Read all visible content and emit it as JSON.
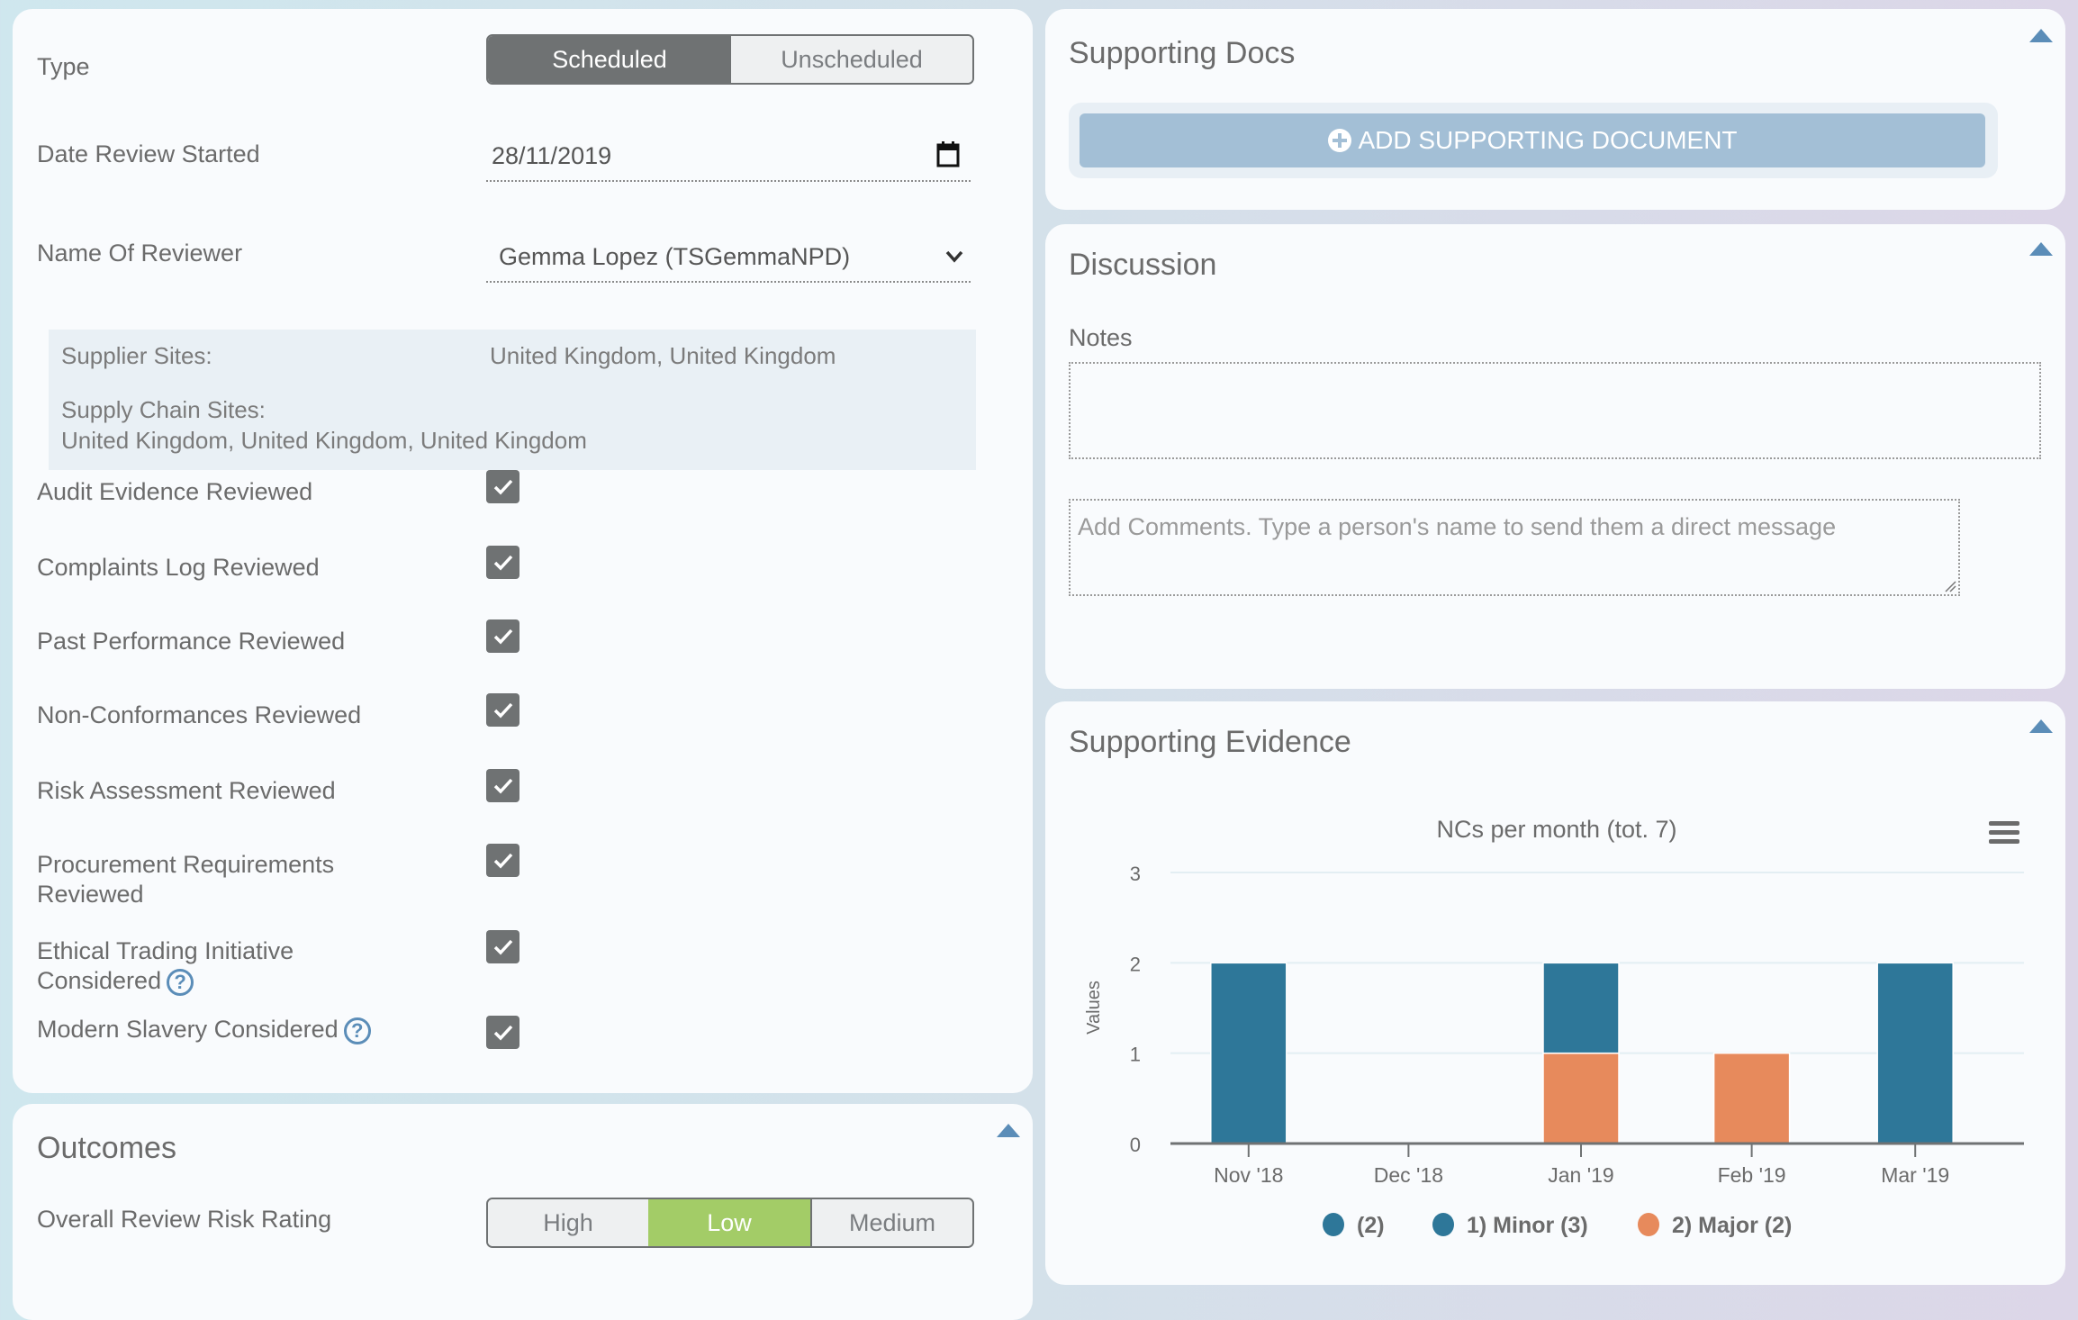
{
  "review": {
    "type_label": "Type",
    "type_options": [
      "Scheduled",
      "Unscheduled"
    ],
    "type_selected": "Scheduled",
    "date_label": "Date Review Started",
    "date_value": "28/11/2019",
    "reviewer_label": "Name Of Reviewer",
    "reviewer_value": "Gemma Lopez (TSGemmaNPD)",
    "supplier_sites_label": "Supplier Sites:",
    "supplier_sites_value": "United Kingdom, United Kingdom",
    "supply_chain_sites_label": "Supply Chain Sites:",
    "supply_chain_sites_value": "United Kingdom, United Kingdom, United Kingdom",
    "checks": [
      {
        "label": "Audit Evidence Reviewed",
        "checked": true
      },
      {
        "label": "Complaints Log Reviewed",
        "checked": true
      },
      {
        "label": "Past Performance Reviewed",
        "checked": true
      },
      {
        "label": "Non-Conformances Reviewed",
        "checked": true
      },
      {
        "label": "Risk Assessment Reviewed",
        "checked": true
      },
      {
        "label_line1": "Procurement Requirements",
        "label_line2": "Reviewed",
        "checked": true
      },
      {
        "label_line1": "Ethical Trading Initiative",
        "label_line2": "Considered",
        "checked": true,
        "help": true
      },
      {
        "label": "Modern Slavery Considered",
        "checked": true,
        "help": true
      }
    ]
  },
  "outcomes": {
    "title": "Outcomes",
    "risk_label": "Overall Review Risk Rating",
    "risk_options": [
      "High",
      "Low",
      "Medium"
    ],
    "risk_selected": "Low"
  },
  "supporting_docs": {
    "title": "Supporting Docs",
    "add_button": "ADD SUPPORTING DOCUMENT"
  },
  "discussion": {
    "title": "Discussion",
    "notes_label": "Notes",
    "notes_value": "",
    "comments_placeholder": "Add Comments. Type a person's name to send them a direct message"
  },
  "supporting_evidence": {
    "title": "Supporting Evidence"
  },
  "colors": {
    "minor": "#2e7799",
    "major": "#e78a5c",
    "accent": "#5b8db8",
    "selected_dark": "#6f7273",
    "selected_green": "#a3cc67"
  },
  "chart_data": {
    "type": "bar",
    "stacked": true,
    "title": "NCs per month (tot. 7)",
    "xlabel": "",
    "ylabel": "Values",
    "categories": [
      "Nov '18",
      "Dec '18",
      "Jan '19",
      "Feb '19",
      "Mar '19"
    ],
    "ylim": [
      0,
      3
    ],
    "yticks": [
      0,
      1,
      2,
      3
    ],
    "grid": true,
    "legend_position": "bottom",
    "series": [
      {
        "name": "(2)",
        "color": "#2e7799",
        "values": [
          2,
          0,
          0,
          0,
          0
        ]
      },
      {
        "name": "1) Minor (3)",
        "color": "#2e7799",
        "values": [
          0,
          0,
          1,
          0,
          2
        ]
      },
      {
        "name": "2) Major (2)",
        "color": "#e78a5c",
        "values": [
          0,
          0,
          1,
          1,
          0
        ]
      }
    ]
  }
}
